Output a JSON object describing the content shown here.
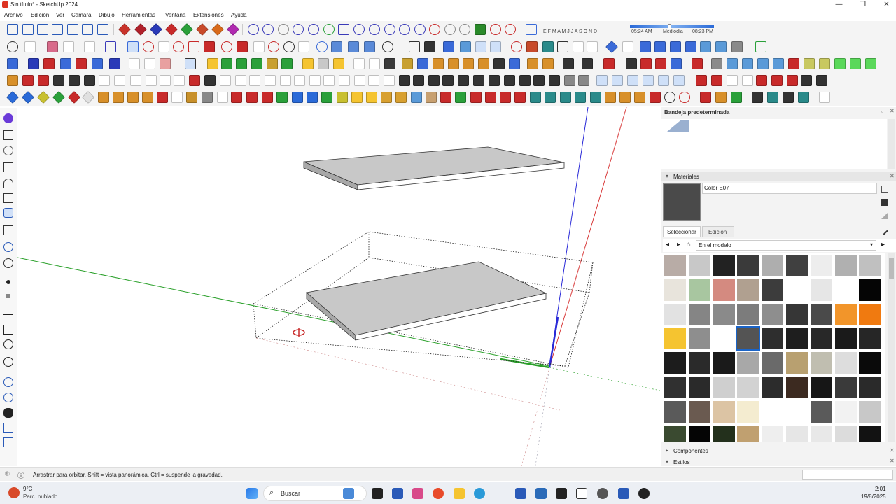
{
  "window": {
    "title": "Sin título* - SketchUp 2024",
    "minimize": "—",
    "maximize": "❐",
    "close": "✕"
  },
  "menu": [
    "Archivo",
    "Edición",
    "Ver",
    "Cámara",
    "Dibujo",
    "Herramientas",
    "Ventana",
    "Extensiones",
    "Ayuda"
  ],
  "shadows": {
    "months": "E F M A M J J A S O N D",
    "time_start": "05:24 AM",
    "time_mid": "Mediodía",
    "time_end": "08:23 PM"
  },
  "tray": {
    "title": "Bandeja predeterminada",
    "materials": {
      "section": "Materiales",
      "name": "Color E07",
      "tabs": [
        "Seleccionar",
        "Edición"
      ],
      "collection": "En el modelo",
      "swatches": [
        [
          "#b8aca6",
          "#c8c8c8",
          "#222222",
          "#3a3a3a",
          "#aeaeae",
          "#404040",
          "#ededed",
          "#b0b0b0",
          "#c0c0c0"
        ],
        [
          "#e8e4dc",
          "#a8c6a0",
          "#d48a80",
          "#b0a090",
          "#3c3c3c",
          "#ffffff",
          "#e6e6e6",
          "#ffffff",
          "#050505"
        ],
        [
          "#e2e2e2",
          "#858585",
          "#8a8a8a",
          "#7c7c7c",
          "#8e8e8e",
          "#363636",
          "#4a4a4a",
          "#f2952a",
          "#f07a10"
        ],
        [
          "#f5c430",
          "#8e8e8e",
          "#ffffff",
          "#545454",
          "#2e2e2e",
          "#1e1e1e",
          "#282828",
          "#1a1a1a",
          "#262626"
        ],
        [
          "#1c1c1c",
          "#2a2a2a",
          "#1a1a1a",
          "#a8a8a8",
          "#6a6a6a",
          "#b8a070",
          "#c0beb0",
          "#dddddd",
          "#0a0a0a"
        ],
        [
          "#303030",
          "#2a2a2a",
          "#cfcfcf",
          "#d2d2d2",
          "#2c2c2c",
          "#3c2a20",
          "#161616",
          "#3a3a3a",
          "#2a2a2a"
        ],
        [
          "#5a5a5a",
          "#6a5a50",
          "#dcc4a4",
          "#f4ecd0",
          "#ffffff",
          "#ffffff",
          "#5a5a5a",
          "#f2f2f2",
          "#c8c8c8"
        ],
        [
          "#3a4a30",
          "#050505",
          "#23301c",
          "#c0a070",
          "#eeeeee",
          "#e6e6e6",
          "#e8e8e8",
          "#dcdcdc",
          "#121212"
        ]
      ]
    },
    "components": "Componentes",
    "styles": "Estilos"
  },
  "status": {
    "text": "Arrastrar para orbitar. Shift = vista panorámica, Ctrl = suspende la gravedad."
  },
  "taskbar": {
    "weather_temp": "9°C",
    "weather_desc": "Parc. nublado",
    "search": "Buscar",
    "time": "2:01",
    "date": "19/8/2025"
  },
  "colors": {
    "axis_red": "#d83a3a",
    "axis_green": "#2aa02a",
    "axis_blue": "#2a2ad8",
    "accent": "#1a64c8"
  }
}
